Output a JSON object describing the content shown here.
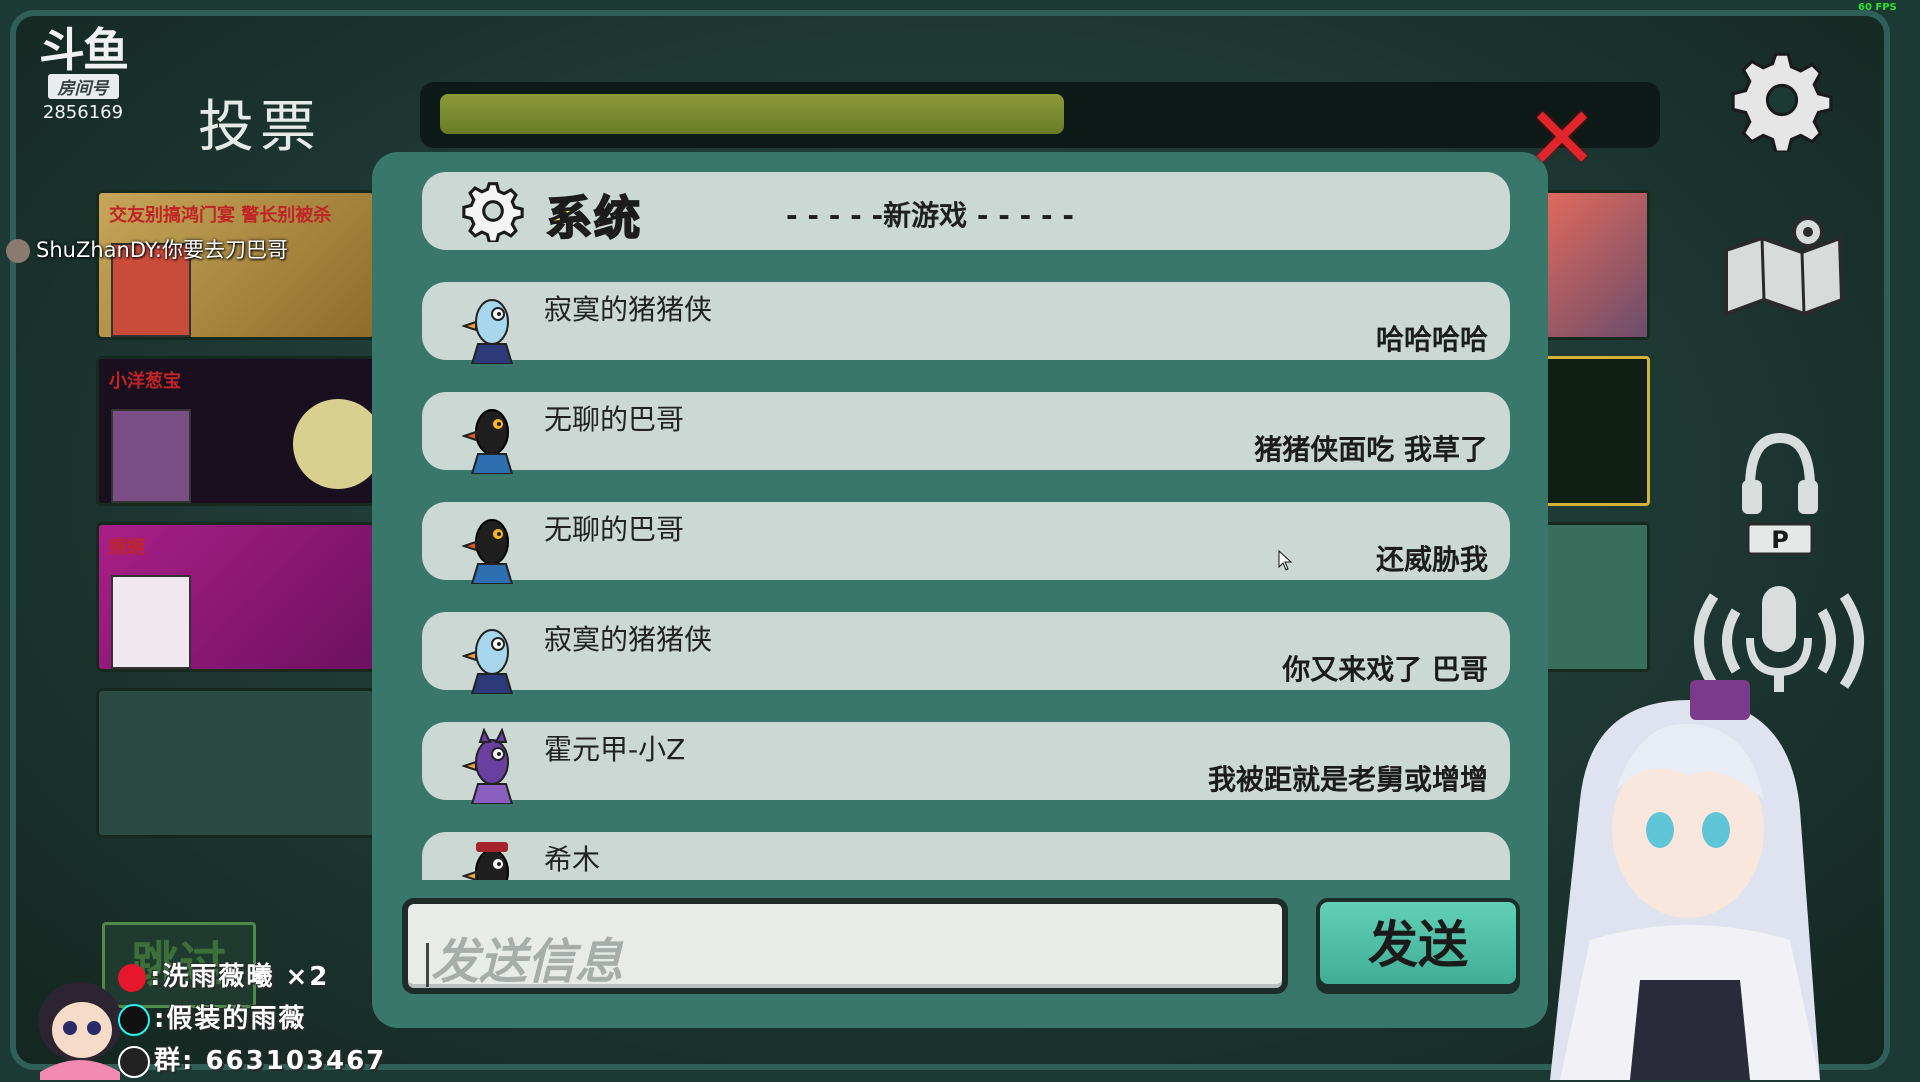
{
  "header": {
    "platform_logo_text": "斗鱼",
    "room_tag": "房间号",
    "room_number": "2856169",
    "screen_title": "投票",
    "fps": "60 FPS"
  },
  "background_cards": [
    {
      "name": "交友别搞鸿门宴 警长别被杀"
    },
    {
      "name": "小洋葱宝"
    },
    {
      "name": "婉婉"
    }
  ],
  "danmu": {
    "text": "ShuZhanDY:你要去刀巴哥"
  },
  "progress": {
    "fraction": 0.52
  },
  "chat": {
    "system": {
      "label": "系统",
      "message": "- - - - -新游戏 - - - - -"
    },
    "messages": [
      {
        "sender": "寂寞的猪猪侠",
        "text": "哈哈哈哈",
        "avatar": "white-goose-avatar"
      },
      {
        "sender": "无聊的巴哥",
        "text": "猪猪侠面吃  我草了",
        "avatar": "dark-goose-avatar"
      },
      {
        "sender": "无聊的巴哥",
        "text": "还威胁我",
        "avatar": "dark-goose-avatar"
      },
      {
        "sender": "寂寞的猪猪侠",
        "text": "你又来戏了 巴哥",
        "avatar": "white-goose-avatar"
      },
      {
        "sender": "霍元甲-小Z",
        "text": "我被距就是老舅或增增",
        "avatar": "purple-goose-avatar"
      },
      {
        "sender": "希木",
        "text": "",
        "avatar": "red-hat-goose-avatar"
      }
    ],
    "input_placeholder": "发送信息",
    "send_label": "发送"
  },
  "skip": {
    "label": "跳过"
  },
  "social": [
    {
      "icon": "weibo-icon",
      "text": ":洗雨薇曦 ×2"
    },
    {
      "icon": "douyin-icon",
      "text": ":假装的雨薇"
    },
    {
      "icon": "qq-icon",
      "text": "群: 663103467"
    }
  ],
  "colors": {
    "panel": "#38776a",
    "row": "#cbd8d3",
    "progress": "#8d9a3a",
    "close": "#e0262b",
    "send": "#4fc0a5",
    "system_label": "#f0e84a"
  }
}
